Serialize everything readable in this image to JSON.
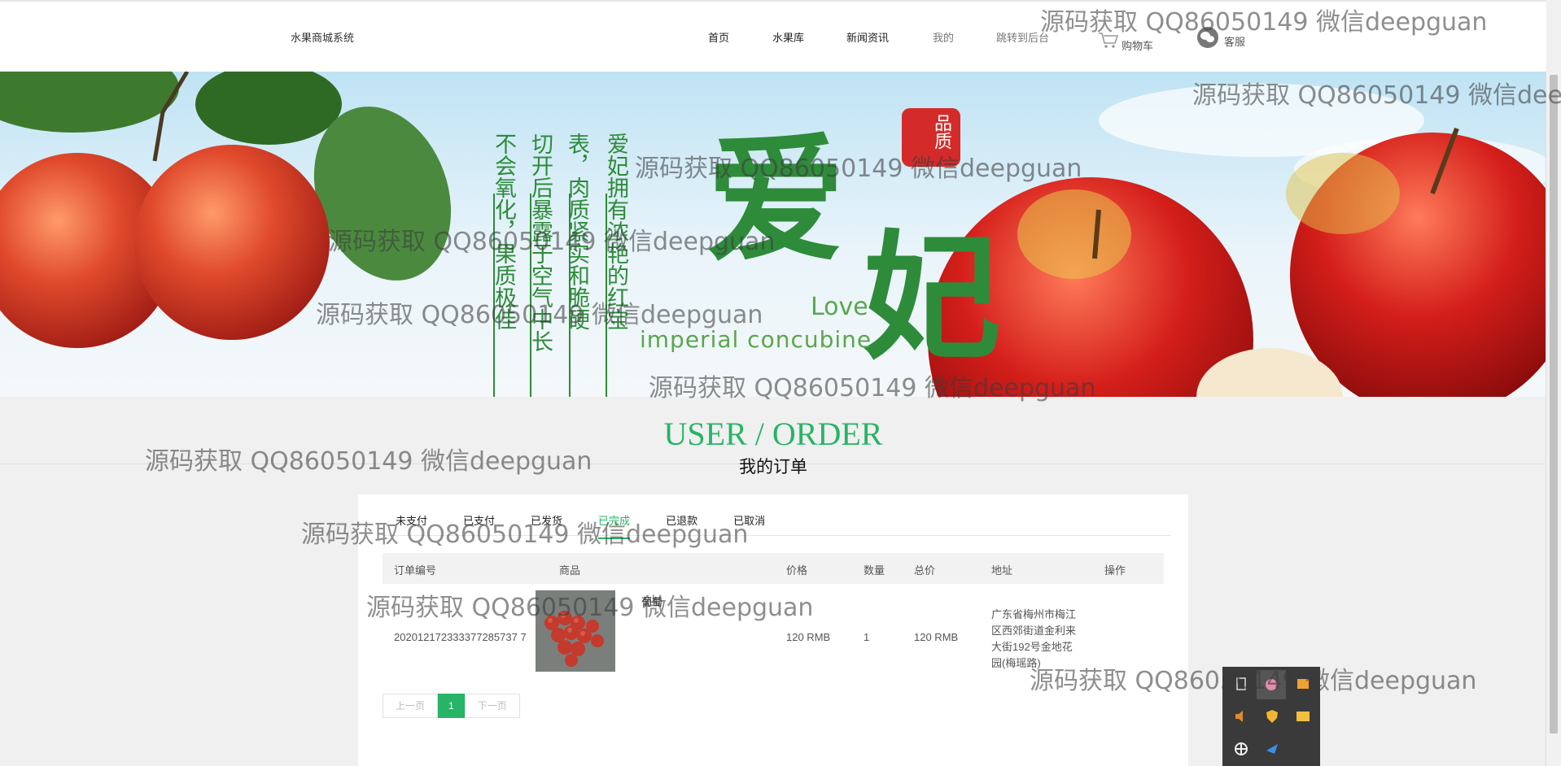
{
  "header": {
    "brand": "水果商城系统",
    "nav": [
      "首页",
      "水果库",
      "新闻资讯",
      "我的",
      "跳转到后台"
    ],
    "cart_label": "购物车",
    "service_label": "客服"
  },
  "banner": {
    "big_chars": [
      "爱",
      "妃"
    ],
    "seal_text": "品质",
    "english_love": "Love",
    "english_sub": "imperial concubine",
    "poem_columns": [
      "爱妃拥有浓艳的红宝",
      "表，肉质紧实和脆硬",
      "切开后暴露于空气中长",
      "不会氧化，果质极佳"
    ]
  },
  "section": {
    "title": "USER / ORDER",
    "subtitle": "我的订单"
  },
  "orders": {
    "tabs": [
      "未支付",
      "已支付",
      "已发货",
      "已完成",
      "已退款",
      "已取消"
    ],
    "active_tab": "已完成",
    "columns": [
      "订单编号",
      "商品",
      "价格",
      "数量",
      "总价",
      "地址",
      "操作"
    ],
    "rows": [
      {
        "order_no": "202012172333377285737 7",
        "product": "葡萄",
        "price": "120 RMB",
        "qty": "1",
        "total": "120 RMB",
        "address": "广东省梅州市梅江区西郊街道金利来大街192号金地花园(梅瑶路)"
      }
    ]
  },
  "pager": {
    "prev": "上一页",
    "current": "1",
    "next": "下一页"
  },
  "watermark": "源码获取 QQ86050149 微信deepguan",
  "colors": {
    "accent": "#27b467",
    "banner_green": "#2e8b3a"
  }
}
